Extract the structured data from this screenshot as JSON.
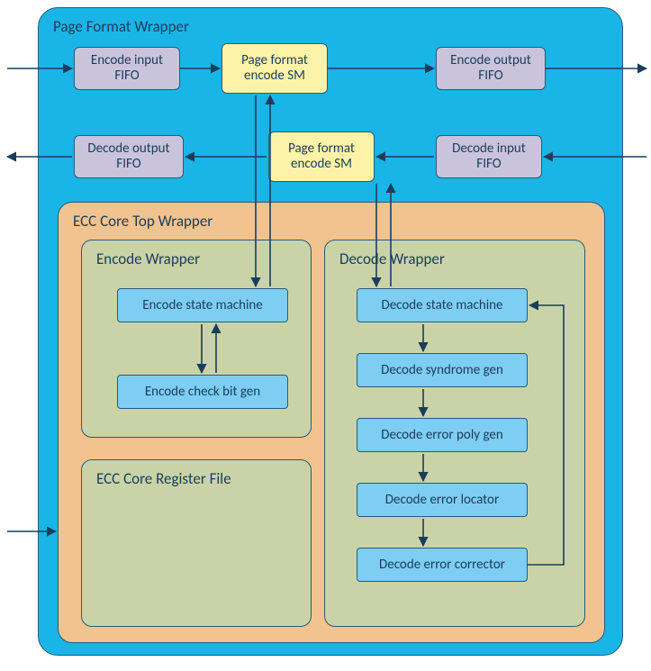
{
  "page_format_wrapper": {
    "title": "Page Format Wrapper",
    "encode_input_fifo": "Encode input\nFIFO",
    "encode_sm": "Page format\nencode SM",
    "encode_output_fifo": "Encode output\nFIFO",
    "decode_output_fifo": "Decode output\nFIFO",
    "decode_sm": "Page format\nencode SM",
    "decode_input_fifo": "Decode input\nFIFO"
  },
  "ecc_core_top": {
    "title": "ECC Core Top Wrapper",
    "encode_wrapper": {
      "title": "Encode Wrapper",
      "state_machine": "Encode state machine",
      "check_bit_gen": "Encode check bit gen"
    },
    "decode_wrapper": {
      "title": "Decode Wrapper",
      "state_machine": "Decode state machine",
      "syndrome_gen": "Decode syndrome gen",
      "error_poly_gen": "Decode error poly gen",
      "error_locator": "Decode error locator",
      "error_corrector": "Decode error corrector"
    },
    "register_file": {
      "title": "ECC Core Register File"
    }
  }
}
